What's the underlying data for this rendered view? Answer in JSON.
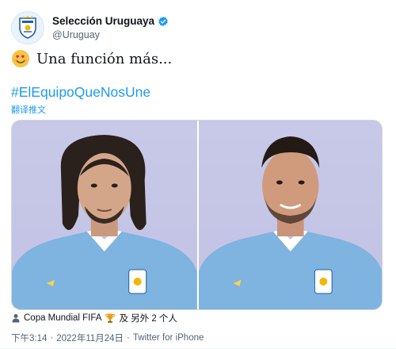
{
  "account": {
    "display_name": "Selección Uruguaya",
    "handle": "@Uruguay"
  },
  "tweet": {
    "text": "Una función más...",
    "hashtag": "#ElEquipoQueNosUne",
    "translate_label": "翻译推文"
  },
  "media": {
    "photos": [
      {
        "icon": "player-photo-1"
      },
      {
        "icon": "player-photo-2"
      }
    ]
  },
  "tags": {
    "location": "Copa Mundial FIFA",
    "others": "及 另外 2 个人"
  },
  "timestamp": {
    "time": "下午3:14",
    "date": "2022年11月24日",
    "separator": "·",
    "source": "Twitter for iPhone"
  },
  "colors": {
    "link": "#1d9bf0",
    "secondary_text": "#536471",
    "jersey": "#6fa8dc"
  }
}
